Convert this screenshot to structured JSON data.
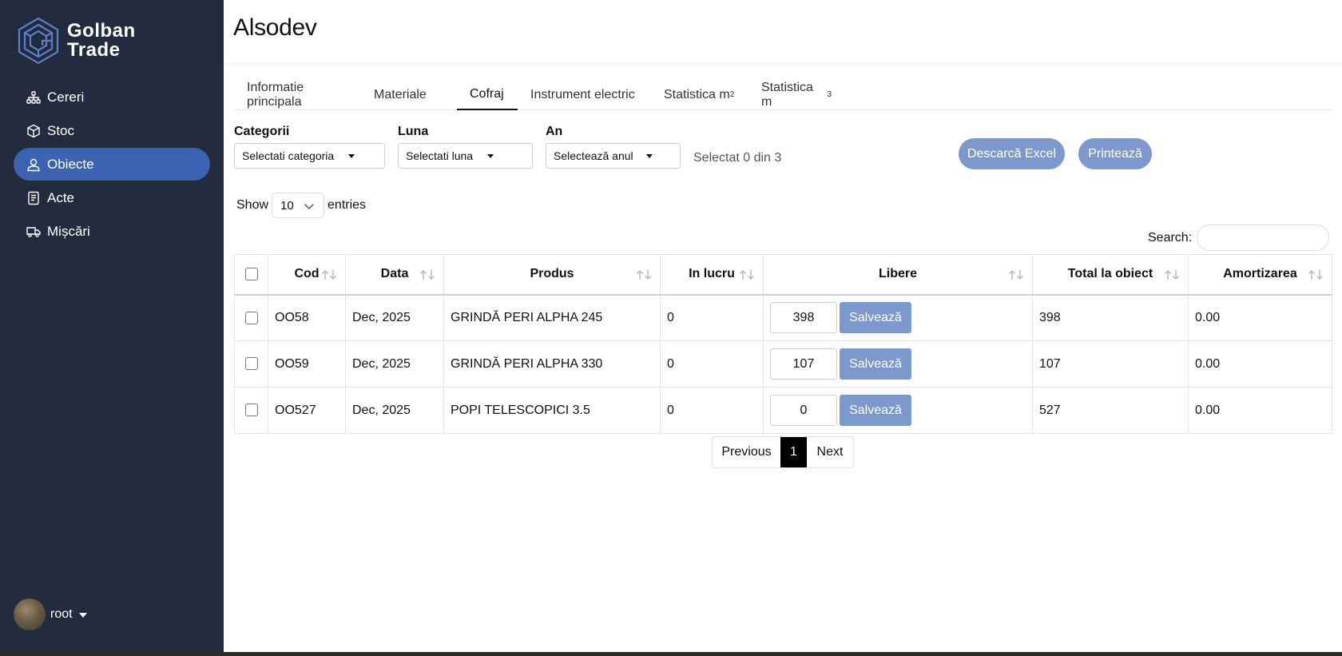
{
  "brand": {
    "line1": "Golban",
    "line2": "Trade"
  },
  "sidebar": {
    "items": [
      {
        "label": "Cereri",
        "icon": "hierarchy-icon"
      },
      {
        "label": "Stoc",
        "icon": "box-icon"
      },
      {
        "label": "Obiecte",
        "icon": "user-icon",
        "active": true
      },
      {
        "label": "Acte",
        "icon": "document-icon"
      },
      {
        "label": "Mișcări",
        "icon": "truck-icon"
      }
    ],
    "user": {
      "name": "root"
    }
  },
  "header": {
    "title": "Alsodev"
  },
  "tabs": [
    {
      "label": "Informatie principala"
    },
    {
      "label": "Materiale"
    },
    {
      "label": "Cofraj",
      "active": true
    },
    {
      "label": "Instrument electric"
    },
    {
      "label": "Statistica m",
      "sup": "2"
    },
    {
      "label": "Statistica m",
      "sup": "3"
    }
  ],
  "filters": {
    "category": {
      "label": "Categorii",
      "value": "Selectati categoria"
    },
    "month": {
      "label": "Luna",
      "value": "Selectati luna"
    },
    "year": {
      "label": "An",
      "value": "Selectează anul"
    },
    "selected_count": "Selectat 0 din 3"
  },
  "actions": {
    "excel": "Descarcă Excel",
    "print": "Printează"
  },
  "table_controls": {
    "show": "Show",
    "entries_value": "10",
    "entries": "entries",
    "search_label": "Search:"
  },
  "table": {
    "columns": [
      "Cod",
      "Data",
      "Produs",
      "In lucru",
      "Libere",
      "Total la obiect",
      "Amortizarea"
    ],
    "save_label": "Salvează",
    "rows": [
      {
        "cod": "OO58",
        "data": "Dec, 2025",
        "produs": "GRINDĂ PERI ALPHA 245",
        "in_lucru": "0",
        "libere": "398",
        "total": "398",
        "amortizarea": "0.00"
      },
      {
        "cod": "OO59",
        "data": "Dec, 2025",
        "produs": "GRINDĂ PERI ALPHA 330",
        "in_lucru": "0",
        "libere": "107",
        "total": "107",
        "amortizarea": "0.00"
      },
      {
        "cod": "OO527",
        "data": "Dec, 2025",
        "produs": "POPI TELESCOPICI 3.5",
        "in_lucru": "0",
        "libere": "0",
        "total": "527",
        "amortizarea": "0.00"
      }
    ]
  },
  "pagination": {
    "previous": "Previous",
    "current": "1",
    "next": "Next"
  },
  "colors": {
    "sidebar_bg": "#222c3e",
    "accent": "#3b63b2",
    "button": "#7d98cc"
  }
}
